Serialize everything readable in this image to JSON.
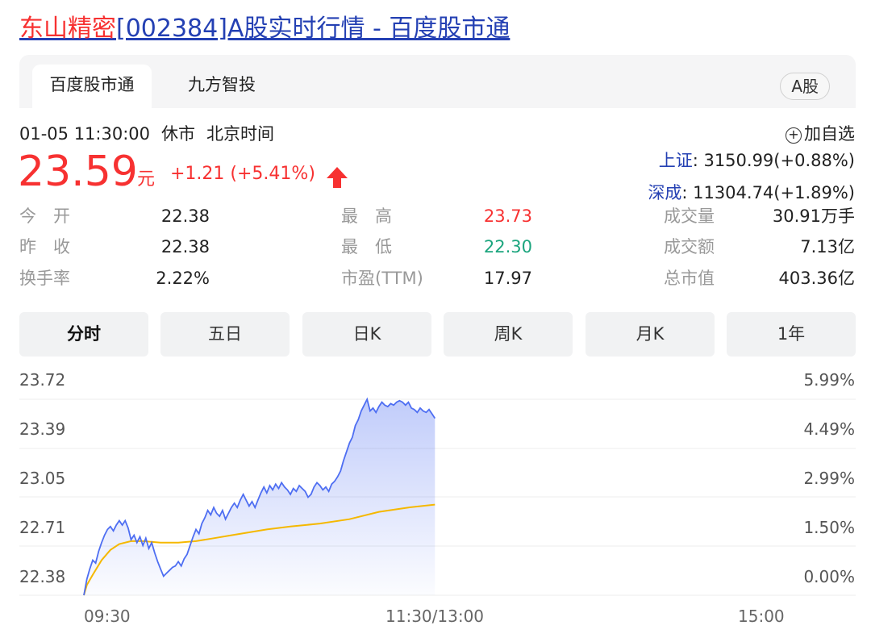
{
  "page": {
    "title_highlight": "东山精密",
    "title_rest": "[002384]A股实时行情 - 百度股市通"
  },
  "tabs": [
    {
      "label": "百度股市通",
      "active": true
    },
    {
      "label": "九方智投",
      "active": false
    }
  ],
  "market_badge": "A股",
  "quote": {
    "datetime": "01-05 11:30:00",
    "status": "休市",
    "timezone": "北京时间",
    "price": "23.59",
    "unit": "元",
    "change": "+1.21 (+5.41%)",
    "direction_icon": "up-arrow-icon"
  },
  "add_watchlist": "加自选",
  "indices": [
    {
      "name": "上证",
      "value": ": 3150.99(+0.88%)"
    },
    {
      "name": "深成",
      "value": ": 11304.74(+1.89%)"
    }
  ],
  "stats": [
    {
      "label": "今　开",
      "value": "22.38",
      "tone": "normal"
    },
    {
      "label": "最　高",
      "value": "23.73",
      "tone": "up"
    },
    {
      "label": "成交量",
      "value": "30.91万手",
      "tone": "normal"
    },
    {
      "label": "昨　收",
      "value": "22.38",
      "tone": "normal"
    },
    {
      "label": "最　低",
      "value": "22.30",
      "tone": "down"
    },
    {
      "label": "成交额",
      "value": "7.13亿",
      "tone": "normal"
    },
    {
      "label": "换手率",
      "value": "2.22%",
      "tone": "normal"
    },
    {
      "label": "市盈(TTM)",
      "value": "17.97",
      "tone": "normal"
    },
    {
      "label": "总市值",
      "value": "403.36亿",
      "tone": "normal"
    }
  ],
  "periods": [
    {
      "label": "分时",
      "active": true
    },
    {
      "label": "五日",
      "active": false
    },
    {
      "label": "日K",
      "active": false
    },
    {
      "label": "周K",
      "active": false
    },
    {
      "label": "月K",
      "active": false
    },
    {
      "label": "1年",
      "active": false
    }
  ],
  "colors": {
    "up": "#f73131",
    "down": "#1ca57e",
    "price_line": "#4e6ef2",
    "avg_line": "#f5b800",
    "link": "#2440b3"
  },
  "chart_data": {
    "type": "area",
    "y_ticks": [
      "23.72",
      "23.39",
      "23.05",
      "22.71",
      "22.38"
    ],
    "pct_ticks": [
      "5.99%",
      "4.49%",
      "2.99%",
      "1.50%",
      "0.00%"
    ],
    "x_ticks": [
      "09:30",
      "11:30/13:00",
      "15:00"
    ],
    "ylim": [
      22.38,
      23.72
    ],
    "x_minutes_total": 240,
    "series": [
      {
        "kind": "price",
        "points": [
          [
            0,
            22.38
          ],
          [
            1,
            22.49
          ],
          [
            2,
            22.56
          ],
          [
            3,
            22.62
          ],
          [
            4,
            22.6
          ],
          [
            5,
            22.68
          ],
          [
            6,
            22.74
          ],
          [
            7,
            22.79
          ],
          [
            8,
            22.83
          ],
          [
            9,
            22.85
          ],
          [
            10,
            22.82
          ],
          [
            11,
            22.86
          ],
          [
            12,
            22.89
          ],
          [
            13,
            22.86
          ],
          [
            14,
            22.89
          ],
          [
            15,
            22.84
          ],
          [
            16,
            22.76
          ],
          [
            17,
            22.79
          ],
          [
            18,
            22.74
          ],
          [
            19,
            22.78
          ],
          [
            20,
            22.72
          ],
          [
            21,
            22.77
          ],
          [
            22,
            22.7
          ],
          [
            23,
            22.74
          ],
          [
            24,
            22.67
          ],
          [
            25,
            22.61
          ],
          [
            26,
            22.56
          ],
          [
            27,
            22.51
          ],
          [
            28,
            22.53
          ],
          [
            29,
            22.55
          ],
          [
            30,
            22.57
          ],
          [
            31,
            22.58
          ],
          [
            32,
            22.61
          ],
          [
            33,
            22.58
          ],
          [
            34,
            22.63
          ],
          [
            35,
            22.66
          ],
          [
            36,
            22.72
          ],
          [
            37,
            22.78
          ],
          [
            38,
            22.83
          ],
          [
            39,
            22.8
          ],
          [
            40,
            22.87
          ],
          [
            41,
            22.91
          ],
          [
            42,
            22.96
          ],
          [
            43,
            22.93
          ],
          [
            44,
            22.98
          ],
          [
            45,
            22.94
          ],
          [
            46,
            22.92
          ],
          [
            47,
            22.96
          ],
          [
            48,
            22.9
          ],
          [
            49,
            22.94
          ],
          [
            50,
            22.98
          ],
          [
            51,
            23.01
          ],
          [
            52,
            22.98
          ],
          [
            53,
            23.03
          ],
          [
            54,
            23.07
          ],
          [
            55,
            23.03
          ],
          [
            56,
            22.99
          ],
          [
            57,
            23.02
          ],
          [
            58,
            22.98
          ],
          [
            59,
            23.03
          ],
          [
            60,
            23.08
          ],
          [
            61,
            23.12
          ],
          [
            62,
            23.08
          ],
          [
            63,
            23.13
          ],
          [
            64,
            23.1
          ],
          [
            65,
            23.14
          ],
          [
            66,
            23.11
          ],
          [
            67,
            23.15
          ],
          [
            68,
            23.12
          ],
          [
            69,
            23.1
          ],
          [
            70,
            23.07
          ],
          [
            71,
            23.11
          ],
          [
            72,
            23.09
          ],
          [
            73,
            23.13
          ],
          [
            74,
            23.11
          ],
          [
            75,
            23.09
          ],
          [
            76,
            23.05
          ],
          [
            77,
            23.07
          ],
          [
            78,
            23.12
          ],
          [
            79,
            23.15
          ],
          [
            80,
            23.13
          ],
          [
            81,
            23.1
          ],
          [
            82,
            23.12
          ],
          [
            83,
            23.09
          ],
          [
            84,
            23.14
          ],
          [
            85,
            23.16
          ],
          [
            86,
            23.19
          ],
          [
            87,
            23.23
          ],
          [
            88,
            23.3
          ],
          [
            89,
            23.36
          ],
          [
            90,
            23.42
          ],
          [
            91,
            23.46
          ],
          [
            92,
            23.54
          ],
          [
            93,
            23.58
          ],
          [
            94,
            23.64
          ],
          [
            95,
            23.68
          ],
          [
            96,
            23.72
          ],
          [
            97,
            23.64
          ],
          [
            98,
            23.66
          ],
          [
            99,
            23.63
          ],
          [
            100,
            23.67
          ],
          [
            101,
            23.7
          ],
          [
            102,
            23.68
          ],
          [
            103,
            23.67
          ],
          [
            104,
            23.69
          ],
          [
            105,
            23.68
          ],
          [
            106,
            23.7
          ],
          [
            107,
            23.71
          ],
          [
            108,
            23.7
          ],
          [
            109,
            23.68
          ],
          [
            110,
            23.7
          ],
          [
            111,
            23.66
          ],
          [
            112,
            23.65
          ],
          [
            113,
            23.63
          ],
          [
            114,
            23.66
          ],
          [
            115,
            23.64
          ],
          [
            116,
            23.63
          ],
          [
            117,
            23.65
          ],
          [
            118,
            23.62
          ],
          [
            119,
            23.59
          ]
        ]
      },
      {
        "kind": "average",
        "points": [
          [
            0,
            22.38
          ],
          [
            1,
            22.45
          ],
          [
            3,
            22.52
          ],
          [
            6,
            22.62
          ],
          [
            9,
            22.69
          ],
          [
            12,
            22.73
          ],
          [
            16,
            22.75
          ],
          [
            20,
            22.75
          ],
          [
            26,
            22.74
          ],
          [
            32,
            22.74
          ],
          [
            38,
            22.75
          ],
          [
            44,
            22.77
          ],
          [
            50,
            22.79
          ],
          [
            56,
            22.81
          ],
          [
            62,
            22.83
          ],
          [
            70,
            22.85
          ],
          [
            80,
            22.87
          ],
          [
            90,
            22.9
          ],
          [
            100,
            22.95
          ],
          [
            110,
            22.98
          ],
          [
            119,
            23.0
          ]
        ]
      }
    ]
  }
}
